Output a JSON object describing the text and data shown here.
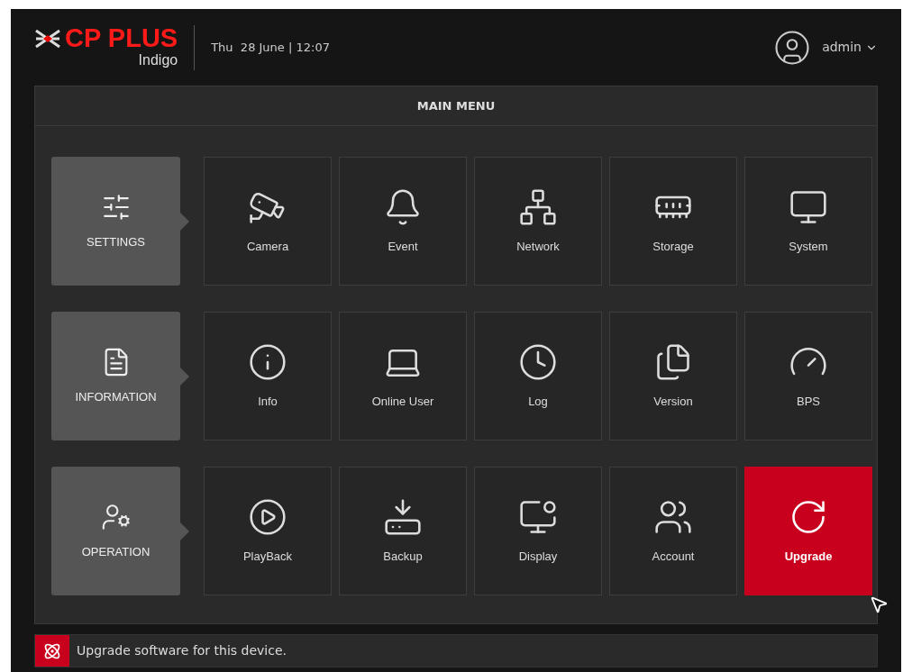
{
  "header": {
    "logo": "CP PLUS",
    "logo_sub": "Indigo",
    "datetime": "Thu  28 June | 12:07",
    "user": "admin"
  },
  "main_menu": {
    "title": "MAIN MENU",
    "rows": [
      {
        "category": "SETTINGS",
        "items": [
          {
            "label": "Camera",
            "selected": false
          },
          {
            "label": "Event",
            "selected": false
          },
          {
            "label": "Network",
            "selected": false
          },
          {
            "label": "Storage",
            "selected": false
          },
          {
            "label": "System",
            "selected": false
          }
        ]
      },
      {
        "category": "INFORMATION",
        "items": [
          {
            "label": "Info",
            "selected": false
          },
          {
            "label": "Online User",
            "selected": false
          },
          {
            "label": "Log",
            "selected": false
          },
          {
            "label": "Version",
            "selected": false
          },
          {
            "label": "BPS",
            "selected": false
          }
        ]
      },
      {
        "category": "OPERATION",
        "items": [
          {
            "label": "PlayBack",
            "selected": false
          },
          {
            "label": "Backup",
            "selected": false
          },
          {
            "label": "Display",
            "selected": false
          },
          {
            "label": "Account",
            "selected": false
          },
          {
            "label": "Upgrade",
            "selected": true
          }
        ]
      }
    ]
  },
  "status_bar": {
    "message": "Upgrade software for this device."
  }
}
